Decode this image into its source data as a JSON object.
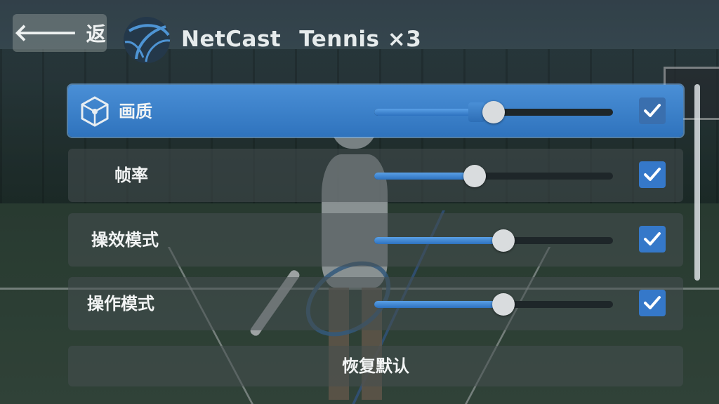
{
  "header": {
    "back_label": "返",
    "app_name": "NetCast",
    "game_name": "Tennis ×3"
  },
  "settings": [
    {
      "label": "画质",
      "level_percent": 50,
      "checked": true,
      "active": true,
      "icon": "graphics-cube-icon"
    },
    {
      "label": "帧率",
      "level_percent": 42,
      "checked": true,
      "active": false
    },
    {
      "label": "操效模式",
      "level_percent": 54,
      "checked": true,
      "active": false
    },
    {
      "label": "操作模式",
      "level_percent": 54,
      "checked": true,
      "active": false
    }
  ],
  "reset_label": "恢复默认",
  "colors": {
    "accent": "#3578c9",
    "active_row": "#3a86d2",
    "row_bg": "#464e50",
    "knob": "#d9dcde"
  }
}
